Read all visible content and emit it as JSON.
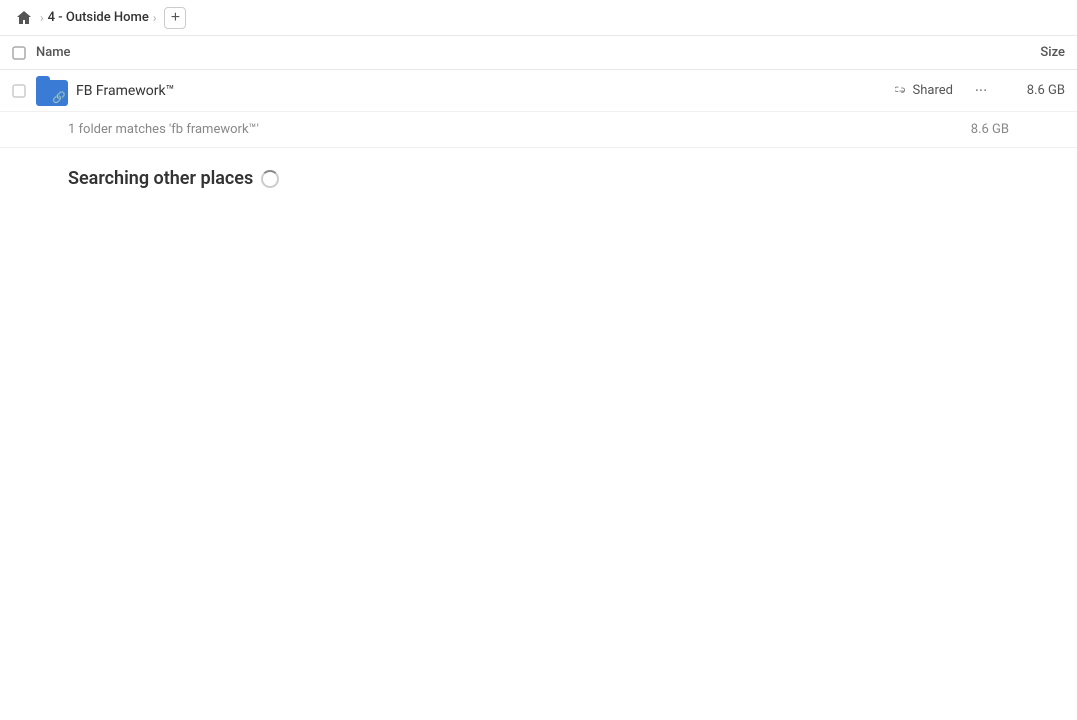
{
  "breadcrumb": {
    "home_icon": "home",
    "path_item": "4 - Outside Home",
    "add_button_label": "+"
  },
  "columns": {
    "name_label": "Name",
    "size_label": "Size"
  },
  "file_row": {
    "name": "FB Framework™",
    "shared_label": "Shared",
    "more_label": "···",
    "size": "8.6 GB"
  },
  "search_info": {
    "matches_text": "1 folder matches 'fb framework™'",
    "size": "8.6 GB"
  },
  "searching_section": {
    "label": "Searching other places"
  }
}
